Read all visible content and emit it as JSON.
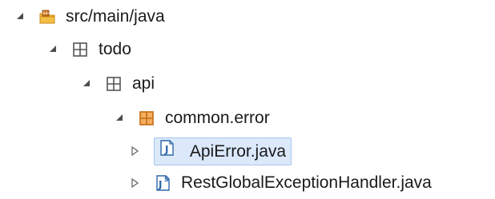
{
  "tree": {
    "nodes": [
      {
        "label": "src/main/java",
        "icon": "source-folder-icon",
        "state": "expanded"
      },
      {
        "label": "todo",
        "icon": "package-icon",
        "state": "expanded"
      },
      {
        "label": "api",
        "icon": "package-icon",
        "state": "expanded"
      },
      {
        "label": "common.error",
        "icon": "package-icon",
        "state": "expanded"
      },
      {
        "label": "ApiError.java",
        "icon": "java-file-icon",
        "state": "collapsed",
        "selected": true
      },
      {
        "label": "RestGlobalExceptionHandler.java",
        "icon": "java-file-icon",
        "state": "collapsed"
      }
    ]
  },
  "colors": {
    "selection_background": "#dbe9fb",
    "selection_border": "#a7c6ee",
    "package_orange": "#c46b12",
    "java_blue": "#2f66a8"
  }
}
